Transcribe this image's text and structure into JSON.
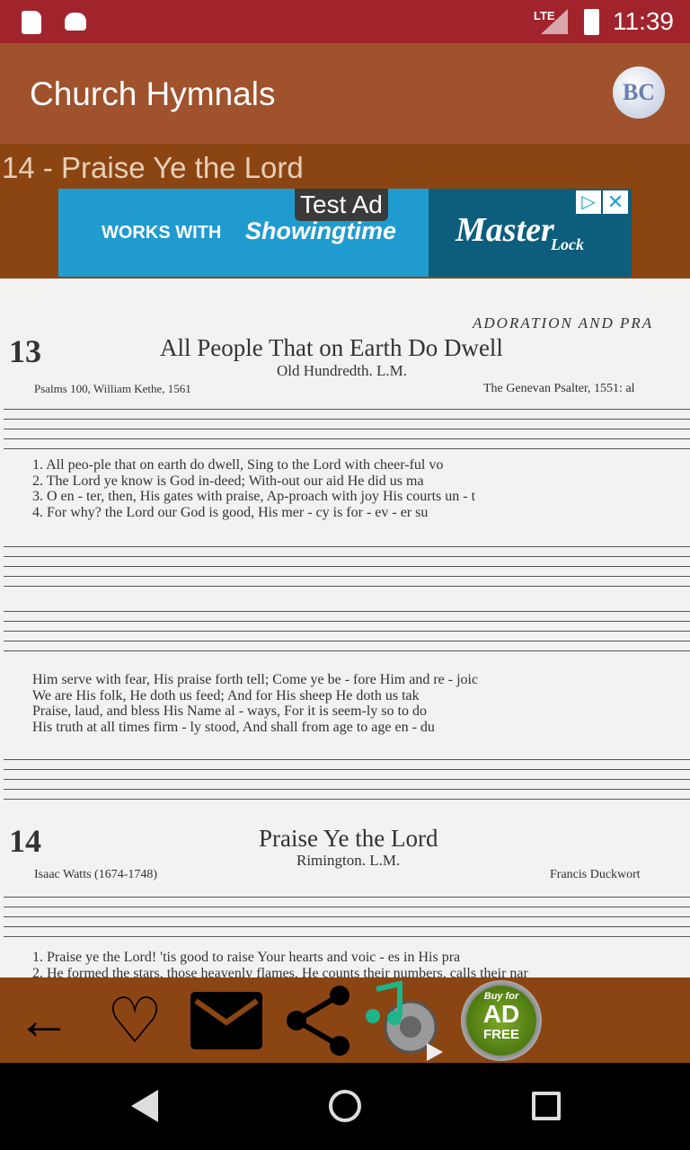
{
  "status_bar": {
    "time": "11:39",
    "network": "LTE",
    "icons": [
      "sd-card-icon",
      "android-icon",
      "signal-icon",
      "battery-charging-icon"
    ]
  },
  "app_bar": {
    "title": "Church Hymnals",
    "logo_text": "BC"
  },
  "hymn_title": "14 - Praise Ye the Lord",
  "ad": {
    "badge": "Test Ad",
    "left_text": "WORKS WITH",
    "brand1": "Showingtime",
    "brand2": "Master",
    "brand2_sub": "Lock"
  },
  "sheet": {
    "section_header": "ADORATION AND PRA",
    "hymn13": {
      "number": "13",
      "title": "All People That on Earth Do Dwell",
      "tune": "Old Hundredth. L.M.",
      "author": "Psalms 100, William Kethe, 1561",
      "composer": "The Genevan Psalter, 1551: al",
      "lyrics1": [
        "1. All  peo-ple that  on earth do dwell, Sing  to  the Lord with cheer-ful vo",
        "2. The Lord ye know is  God  in-deed; With-out our aid He did us ma",
        "3. O   en - ter, then, His gates with praise, Ap-proach with joy His courts un - t",
        "4. For why? the Lord our God is  good, His  mer - cy  is  for - ev - er  su"
      ],
      "lyrics2": [
        "Him  serve with fear, His praise forth tell; Come ye  be - fore  Him and  re - joic",
        "We   are His folk, He doth us feed; And  for His sheep He doth us tak",
        "Praise, laud, and bless His Name al - ways, For  it  is  seem-ly  so  to  do",
        "His  truth at  all times firm - ly stood, And shall from age to  age en - du"
      ]
    },
    "hymn14": {
      "number": "14",
      "title": "Praise Ye the Lord",
      "tune": "Rimington. L.M.",
      "author": "Isaac Watts (1674-1748)",
      "composer": "Francis Duckwort",
      "lyrics": [
        "1. Praise ye the Lord! 'tis good  to  raise  Your hearts and voic - es  in His pra",
        "2. He formed the stars, those heavenly flames, He counts their numbers, calls their nar"
      ]
    }
  },
  "toolbar": {
    "buttons": [
      "back",
      "favorite",
      "email",
      "share",
      "play-music",
      "buy-ad-free"
    ],
    "ad_free_top": "Buy for",
    "ad_free_main": "AD",
    "ad_free_sub": "FREE"
  }
}
